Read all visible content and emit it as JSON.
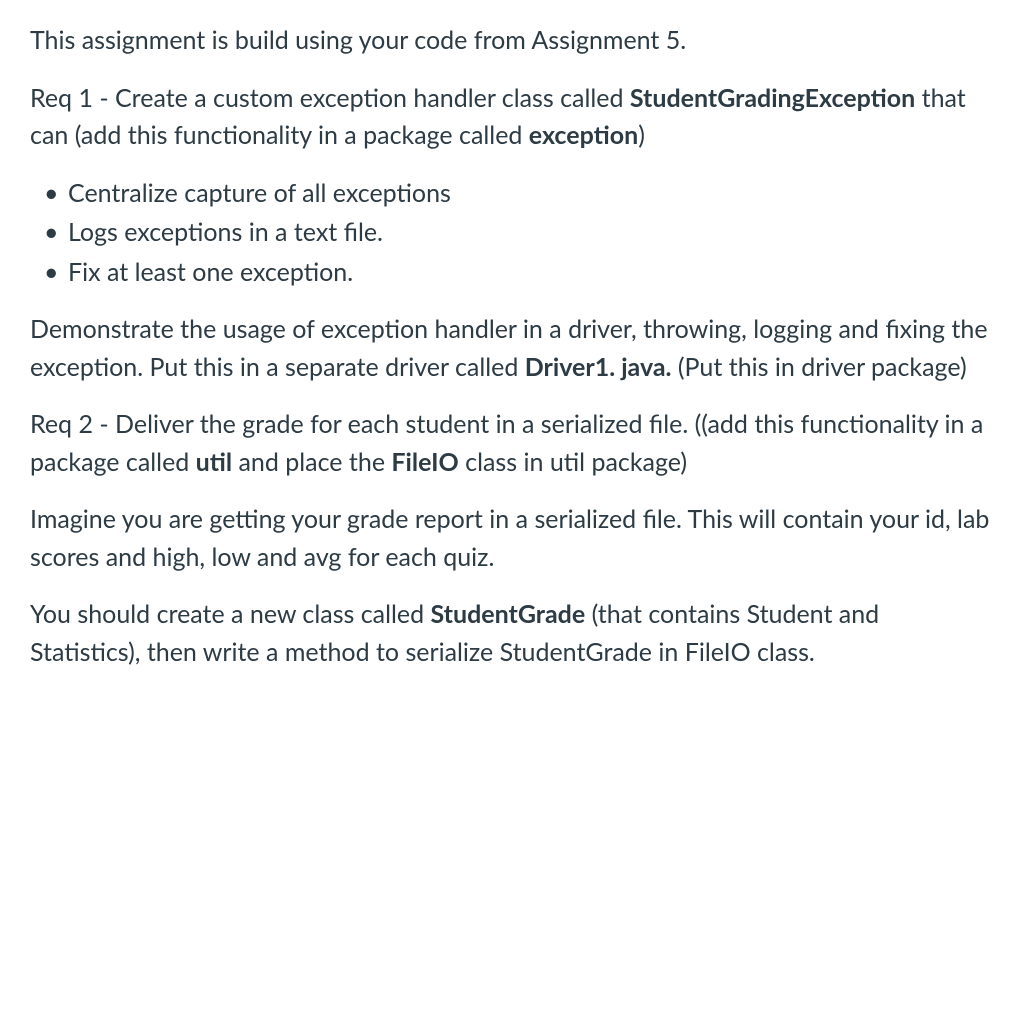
{
  "paragraphs": {
    "intro": "This assignment is build using your code from Assignment 5.",
    "req1_pre": "Req 1 - Create a custom exception handler class called ",
    "req1_bold1": "StudentGradingException",
    "req1_mid": " that can (add this functionality in a package called ",
    "req1_bold2": "exception",
    "req1_post": ")",
    "bullets": [
      "Centralize capture of all exceptions",
      "Logs exceptions in a text file.",
      "Fix at least one exception."
    ],
    "demo_pre": "Demonstrate the usage of exception handler in a driver, throwing, logging and fixing the exception. Put this in a separate driver called ",
    "demo_bold": "Driver1. java.",
    "demo_post": "  (Put this in driver package)",
    "req2_pre": "Req 2 - Deliver the grade for each student in a serialized file. ((add this functionality in a package called ",
    "req2_bold1": "util",
    "req2_mid": " and place the ",
    "req2_bold2": "FileIO",
    "req2_post": " class in util package)",
    "imagine": "Imagine you are getting your grade report in a serialized file. This will contain your id, lab scores and high, low and avg for each quiz.",
    "create_pre": "You should create a new class called ",
    "create_bold": "StudentGrade",
    "create_post": " (that contains Student and Statistics), then write a method to serialize StudentGrade in FileIO class."
  }
}
